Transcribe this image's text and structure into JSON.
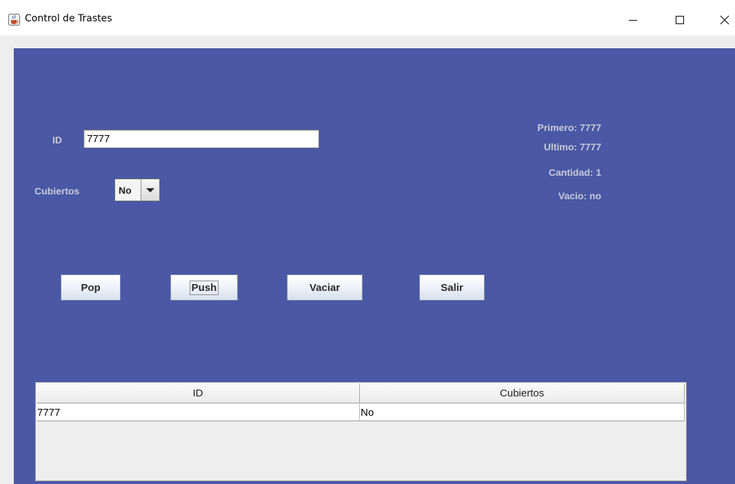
{
  "window": {
    "title": "Control de Trastes",
    "app_icon": "java-cup-icon",
    "controls": [
      "minimize-icon",
      "maximize-icon",
      "close-icon"
    ]
  },
  "form": {
    "id_label": "ID",
    "id_value": "7777",
    "cubiertos_label": "Cubiertos",
    "cubiertos_selected": "No"
  },
  "stats": {
    "primero": "Primero: 7777",
    "ultimo": "Ultimo: 7777",
    "cantidad": "Cantidad: 1",
    "vacio": "Vacio: no"
  },
  "buttons": {
    "pop": "Pop",
    "push": "Push",
    "vaciar": "Vaciar",
    "salir": "Salir"
  },
  "table": {
    "headers": [
      "ID",
      "Cubiertos"
    ],
    "rows": [
      [
        "7777",
        "No"
      ]
    ]
  },
  "colors": {
    "panel_bg": "#4a58a5",
    "label_text": "#c8cad6",
    "frame_bg": "#eeeeee"
  }
}
